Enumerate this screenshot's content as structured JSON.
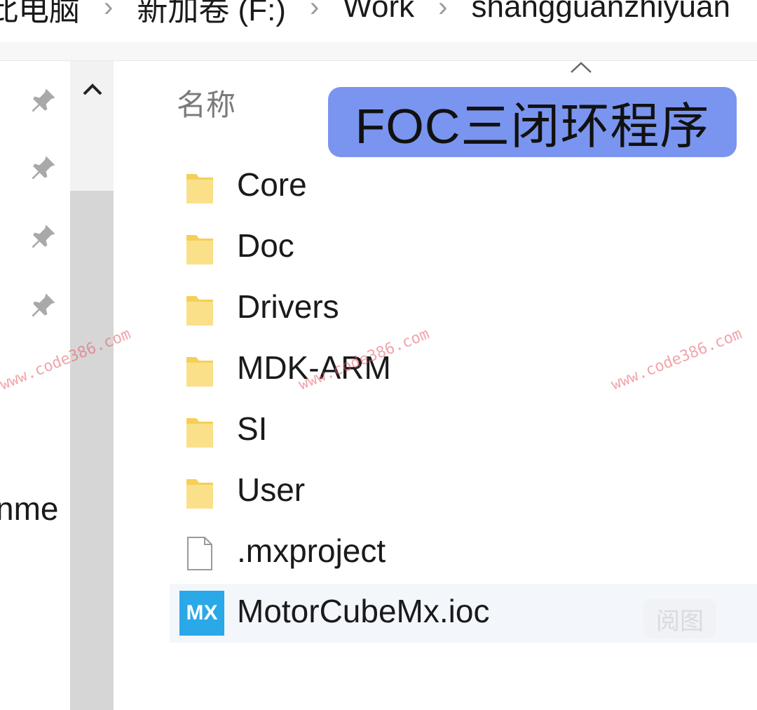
{
  "breadcrumb": {
    "items": [
      "此电脑",
      "新加卷 (F:)",
      "Work",
      "shangguanzhiyuan"
    ],
    "separator": "›"
  },
  "nav": {
    "pins": [
      "pin-icon",
      "pin-icon",
      "pin-icon",
      "pin-icon"
    ],
    "partial_item_text": "nme"
  },
  "list": {
    "column_header": "名称",
    "items": [
      {
        "name": "Core",
        "type": "folder"
      },
      {
        "name": "Doc",
        "type": "folder"
      },
      {
        "name": "Drivers",
        "type": "folder"
      },
      {
        "name": "MDK-ARM",
        "type": "folder"
      },
      {
        "name": "SI",
        "type": "folder"
      },
      {
        "name": "User",
        "type": "folder"
      },
      {
        "name": ".mxproject",
        "type": "file"
      },
      {
        "name": "MotorCubeMx.ioc",
        "type": "ioc",
        "icon_label": "MX",
        "selected": true
      }
    ],
    "hover_button_label": "阅图"
  },
  "overlay": {
    "banner_text": "FOC三闭环程序",
    "banner_color": "#7a95ef"
  },
  "watermark": {
    "text": "www.code386.com"
  },
  "colors": {
    "folder": "#f5cf57",
    "mx_icon": "#2aa8e8",
    "selected_row": "#f3f7fc"
  }
}
